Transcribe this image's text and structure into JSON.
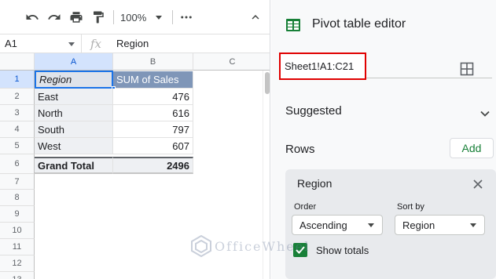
{
  "toolbar": {
    "zoom": "100%",
    "icons": [
      "undo-icon",
      "redo-icon",
      "print-icon",
      "paint-format-icon",
      "more-icon",
      "collapse-icon"
    ]
  },
  "formula_bar": {
    "cell_ref": "A1",
    "fx_label": "fx",
    "value": "Region"
  },
  "columns": [
    "A",
    "B",
    "C"
  ],
  "rows": [
    "1",
    "2",
    "3",
    "4",
    "5",
    "6",
    "7",
    "8",
    "9",
    "10",
    "11",
    "12",
    "13"
  ],
  "table": {
    "header": [
      "Region",
      "SUM of Sales"
    ],
    "data": [
      [
        "East",
        "476"
      ],
      [
        "North",
        "616"
      ],
      [
        "South",
        "797"
      ],
      [
        "West",
        "607"
      ]
    ],
    "total": [
      "Grand Total",
      "2496"
    ]
  },
  "panel": {
    "title": "Pivot table editor",
    "range": "Sheet1!A1:C21",
    "suggested": "Suggested",
    "rows_label": "Rows",
    "add_label": "Add",
    "card": {
      "title": "Region",
      "order_label": "Order",
      "order_value": "Ascending",
      "sortby_label": "Sort by",
      "sortby_value": "Region",
      "show_totals": "Show totals",
      "show_totals_checked": true
    }
  },
  "watermark": "OfficeWheel",
  "colors": {
    "accent": "#1a73e8",
    "header_fill": "#7f96b8",
    "range_highlight": "#e00000",
    "add_green": "#188038"
  }
}
